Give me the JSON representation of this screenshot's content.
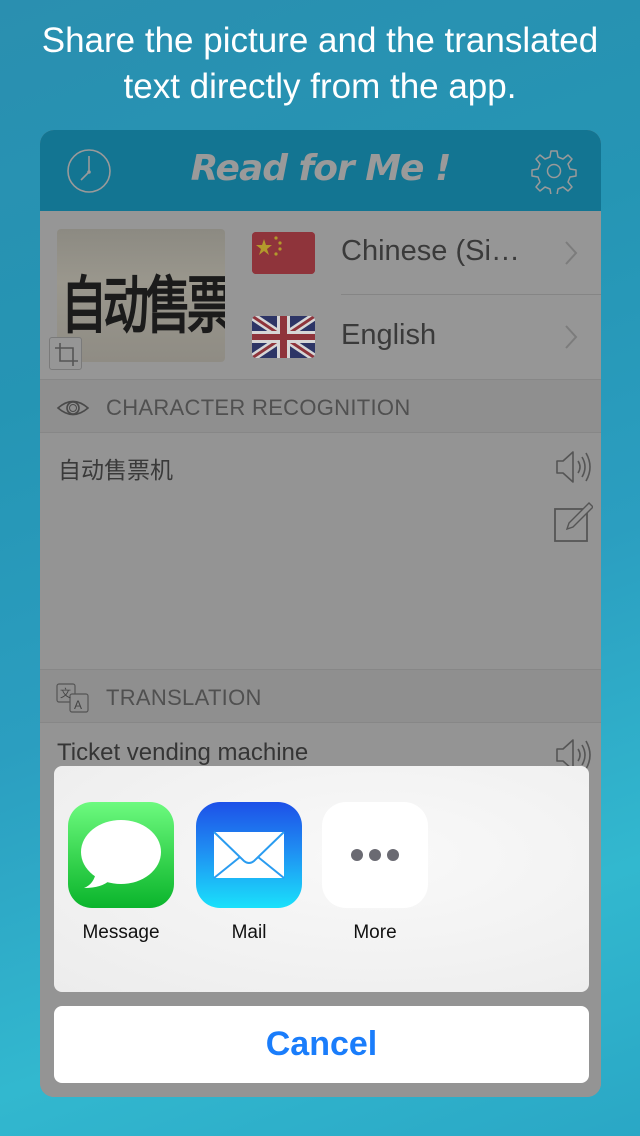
{
  "promo": {
    "line1": "Share the picture and the translated",
    "line2": "text directly from the app."
  },
  "navbar": {
    "title": "Read for Me !",
    "left_icon": "clock-icon",
    "right_icon": "gear-icon"
  },
  "photo": {
    "text": "自动售票机",
    "crop_icon": "crop-icon"
  },
  "languages": {
    "source": {
      "name": "Chinese (Si…",
      "flag": "china-flag"
    },
    "target": {
      "name": "English",
      "flag": "uk-flag"
    }
  },
  "sections": {
    "recognition": {
      "label": "CHARACTER RECOGNITION",
      "icon": "eye-icon",
      "text": "自动售票机"
    },
    "translation": {
      "label": "TRANSLATION",
      "icon": "translate-icon",
      "text": "Ticket vending machine"
    }
  },
  "share_sheet": {
    "items": [
      {
        "label": "Message",
        "icon": "message-icon"
      },
      {
        "label": "Mail",
        "icon": "mail-icon"
      },
      {
        "label": "More",
        "icon": "more-icon"
      }
    ],
    "cancel_label": "Cancel"
  },
  "colors": {
    "navbar": "#137592",
    "cancel_text": "#1a7dfb",
    "overlay": "#979797"
  }
}
